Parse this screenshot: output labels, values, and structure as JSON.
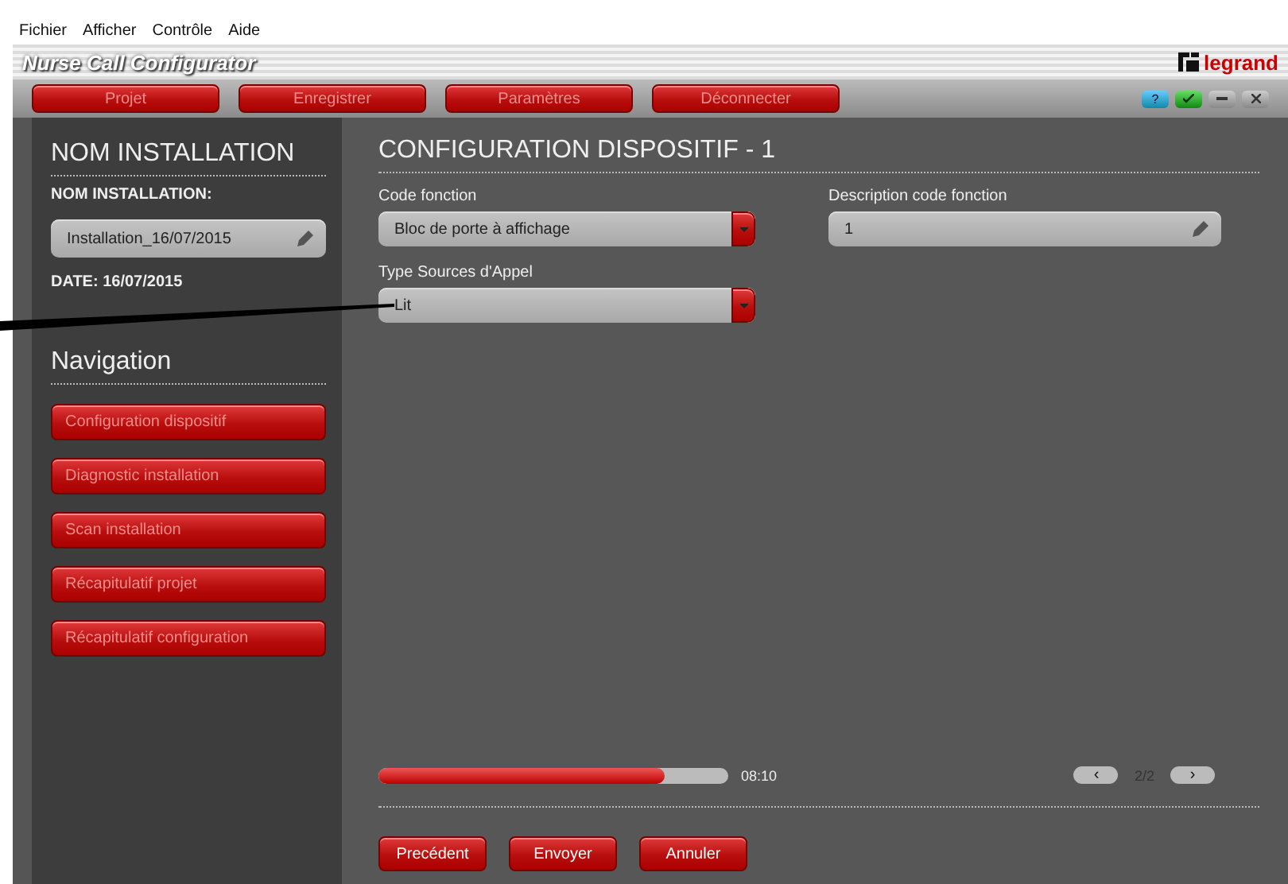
{
  "menu": [
    "Fichier",
    "Afficher",
    "Contrôle",
    "Aide"
  ],
  "window": {
    "title": "Nurse Call Configurator",
    "logo": "legrand"
  },
  "toolbar": {
    "buttons": [
      "Projet",
      "Enregistrer",
      "Paramètres",
      "Déconnecter"
    ],
    "help": "?"
  },
  "sidebar": {
    "heading": "NOM INSTALLATION",
    "name_label": "NOM INSTALLATION:",
    "name_value": "Installation_16/07/2015",
    "date": "DATE: 16/07/2015",
    "nav_heading": "Navigation",
    "nav_items": [
      {
        "label": "Configuration dispositif",
        "selected": false
      },
      {
        "label": "Diagnostic installation",
        "selected": false
      },
      {
        "label": "Scan installation",
        "selected": false
      },
      {
        "label": "Récapitulatif projet",
        "selected": false
      },
      {
        "label": "Récapitulatif configuration",
        "selected": false
      }
    ]
  },
  "main": {
    "heading": "CONFIGURATION DISPOSITIF - 1",
    "fields": [
      {
        "kind": "select",
        "label": "Code fonction",
        "value": "Bloc de porte à affichage"
      },
      {
        "kind": "text",
        "label": "Description code fonction",
        "value": "1"
      },
      {
        "kind": "select",
        "label": "Type Sources d'Appel",
        "value": "Lit"
      }
    ],
    "progress": {
      "level": 0.82,
      "reading": "08:10"
    },
    "pager": {
      "prev": "‹",
      "page": "2/2",
      "next": "›"
    },
    "actions": [
      "Precédent",
      "Envoyer",
      "Annuler"
    ]
  }
}
